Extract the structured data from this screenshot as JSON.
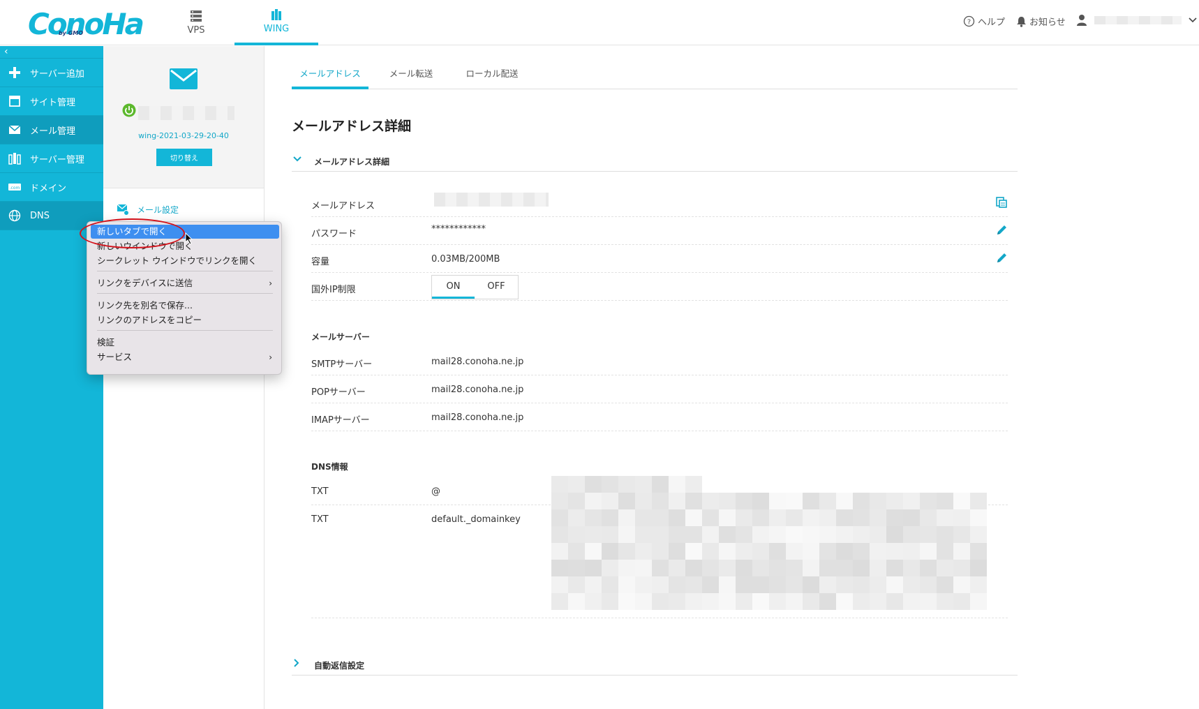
{
  "header": {
    "logo": "ConoHa",
    "logo_sub": "by GMO",
    "tabs": [
      {
        "label": "VPS",
        "icon": "server-stack-icon"
      },
      {
        "label": "WING",
        "icon": "wing-server-icon"
      }
    ],
    "help_label": "ヘルプ",
    "notice_label": "お知らせ"
  },
  "sidebar": {
    "collapse": "‹",
    "items": [
      {
        "label": "サーバー追加",
        "icon": "plus-icon"
      },
      {
        "label": "サイト管理",
        "icon": "window-icon"
      },
      {
        "label": "メール管理",
        "icon": "mail-icon"
      },
      {
        "label": "サーバー管理",
        "icon": "server-icon"
      },
      {
        "label": "ドメイン",
        "icon": "domain-icon"
      },
      {
        "label": "DNS",
        "icon": "globe-icon"
      }
    ]
  },
  "subpanel": {
    "account_id": "wing-2021-03-29-20-40",
    "switch_button": "切り替え",
    "menu_item": "メール設定"
  },
  "context_menu": {
    "items": [
      "新しいタブで開く",
      "新しいウインドウで開く",
      "シークレット ウインドウでリンクを開く",
      "リンクをデバイスに送信",
      "リンク先を別名で保存...",
      "リンクのアドレスをコピー",
      "検証",
      "サービス"
    ]
  },
  "main": {
    "tabs": [
      "メールアドレス",
      "メール転送",
      "ローカル配送"
    ],
    "page_title": "メールアドレス詳細",
    "section_title": "メールアドレス詳細",
    "rows": {
      "email_label": "メールアドレス",
      "password_label": "パスワード",
      "password_value": "************",
      "capacity_label": "容量",
      "capacity_value": "0.03MB/200MB",
      "ip_label": "国外IP制限",
      "toggle_on": "ON",
      "toggle_off": "OFF"
    },
    "mail_server": {
      "heading": "メールサーバー",
      "smtp_label": "SMTPサーバー",
      "smtp_value": "mail28.conoha.ne.jp",
      "pop_label": "POPサーバー",
      "pop_value": "mail28.conoha.ne.jp",
      "imap_label": "IMAPサーバー",
      "imap_value": "mail28.conoha.ne.jp"
    },
    "dns": {
      "heading": "DNS情報",
      "rows": [
        {
          "type": "TXT",
          "name": "@"
        },
        {
          "type": "TXT",
          "name": "default._domainkey"
        }
      ]
    },
    "autoreply_title": "自動返信設定"
  },
  "colors": {
    "accent": "#13b6d8",
    "highlight": "#3e8ff0",
    "annotation": "#d2121b"
  }
}
